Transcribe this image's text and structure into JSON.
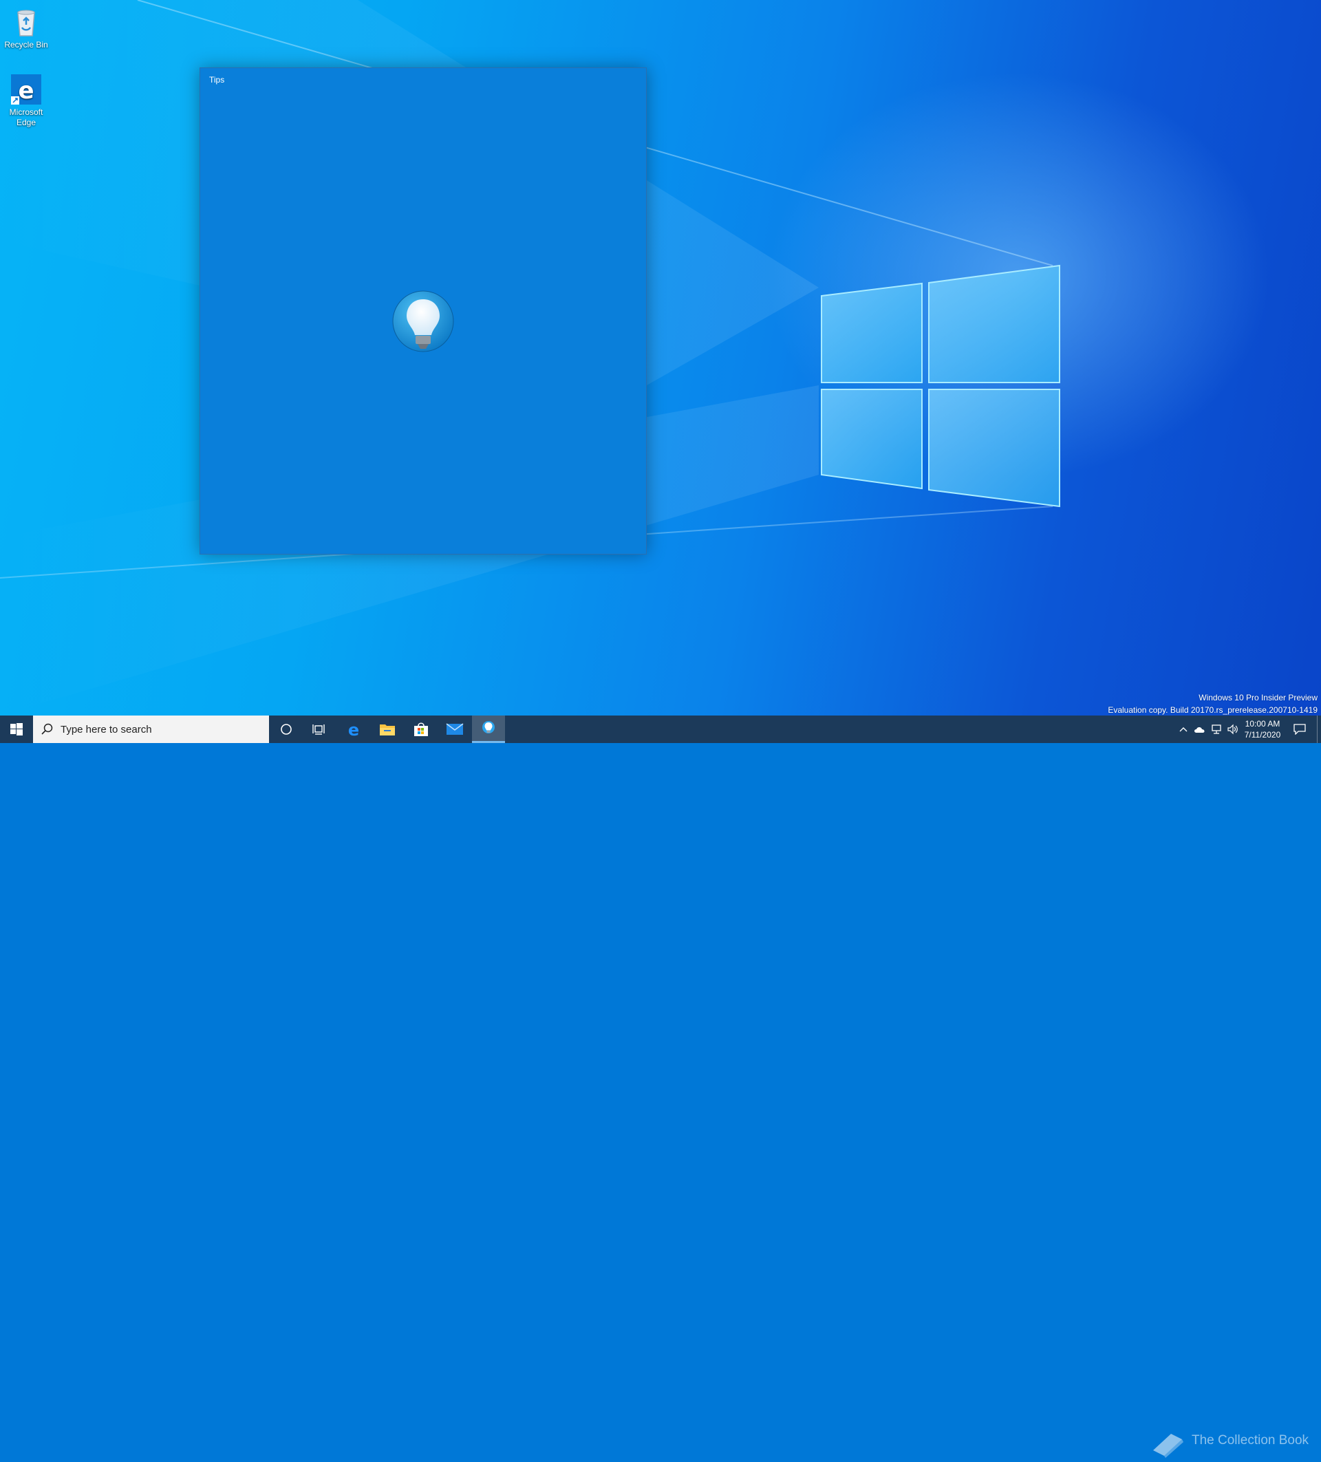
{
  "desktop": {
    "icons": [
      {
        "label": "Recycle Bin"
      },
      {
        "label": "Microsoft Edge"
      }
    ]
  },
  "tips_window": {
    "title": "Tips",
    "logo_icon": "lightbulb-icon"
  },
  "watermark": {
    "line1": "Windows 10 Pro Insider Preview",
    "line2": "Evaluation copy. Build 20170.rs_prerelease.200710-1419"
  },
  "taskbar": {
    "search_placeholder": "Type here to search",
    "pinned": [
      "cortana-icon",
      "task-view-icon",
      "edge-icon",
      "file-explorer-icon",
      "store-icon",
      "mail-icon",
      "tips-icon"
    ],
    "active_app": "Tips",
    "clock": {
      "time": "10:00 AM",
      "date": "7/11/2020"
    },
    "brand_overlay": "The Collection Book"
  },
  "colors": {
    "window_bg": "#0a7fda",
    "taskbar_bg": "#1c3a5a",
    "accent": "#76b9ed"
  }
}
